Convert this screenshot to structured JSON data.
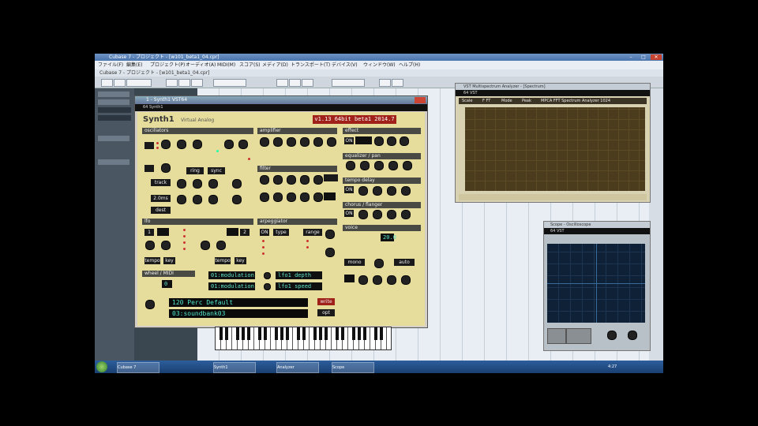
{
  "host": {
    "title": "Cubase 7 - プロジェクト - [w101_beta1_04.cpr]",
    "window_controls": [
      "–",
      "□",
      "✕"
    ],
    "menu": [
      "ファイル(F)",
      "編集(E)",
      "プロジェクト(P)",
      "オーディオ(A)",
      "MIDI(M)",
      "スコア(S)",
      "メディア(D)",
      "トランスポート(T)",
      "デバイス(V)",
      "ウィンドウ(W)",
      "ヘルプ(H)"
    ],
    "project_bar": "Cubase 7 - プロジェクト - [w101_beta1_04.cpr]"
  },
  "synth": {
    "window_title": "1 - Synth1 VST64",
    "host_bar": "64 Synth1",
    "name": "Synth1",
    "subtitle": "Virtual Analog",
    "version": "v1.13 64bit beta1 2014.7",
    "sections": {
      "oscillators": "oscillators",
      "amplifier": "amplifier",
      "filter": "filter",
      "effect": "effect",
      "equalizer": "equalizer / pan",
      "tempo_delay": "tempo delay",
      "chorus": "chorus / flanger",
      "lfo": "lfo",
      "arpeggiator": "arpeggiator",
      "voice": "voice",
      "wheel": "wheel / MIDI"
    },
    "buttons": {
      "ring": "ring",
      "sync": "sync",
      "track": "track",
      "amt": "2.0ms",
      "dest": "dest",
      "tempo1": "tempo",
      "key1": "key",
      "tempo2": "tempo",
      "key2": "key",
      "type": "type",
      "range": "range",
      "on_arp": "ON",
      "on_eff": "ON",
      "on_delay": "ON",
      "on_chorus": "ON",
      "mono": "mono",
      "auto": "auto",
      "opt": "opt",
      "write": "write"
    },
    "midi_assign": [
      "01:modulation",
      "01:modulation",
      "lfo1 depth",
      "lfo1 speed"
    ],
    "lcd_values": [
      "20.0",
      "0"
    ],
    "patch_name": "120 Perc Default",
    "bank_name": "03:soundbank03",
    "lfo_dest_1": "1",
    "lfo_dest_2": "2"
  },
  "analyzer": {
    "window_title": "VST Multispectrum Analyzer - [Spectrum]",
    "host_bar": "64 VST",
    "header": [
      "Scale",
      "F FT",
      "Mode",
      "Peak",
      "MPCA FFT Spectrum Analyzer 1024"
    ]
  },
  "scope": {
    "window_title": "Scope - Oscilloscope",
    "host_bar": "64 VST"
  },
  "taskbar": {
    "items": [
      "Cubase 7",
      "Synth1",
      "Analyzer",
      "Scope"
    ],
    "clock": "4:27"
  }
}
